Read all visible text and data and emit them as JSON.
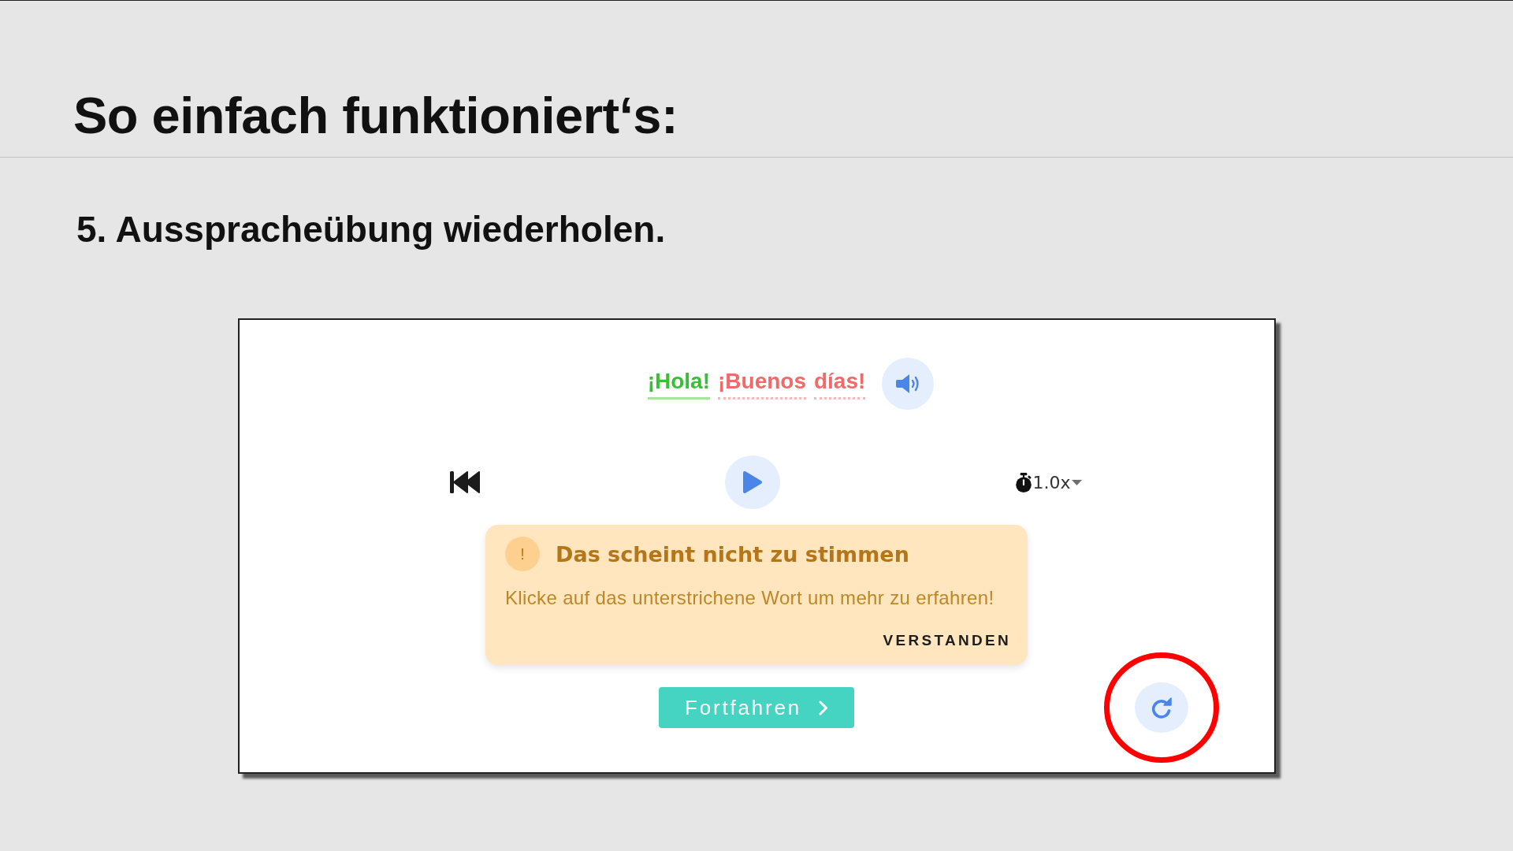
{
  "slide": {
    "title": "So einfach funktioniert‘s:",
    "step": "5. Ausspracheübung wiederholen."
  },
  "exercise": {
    "phrase": [
      {
        "text": "¡Hola!",
        "correct": true
      },
      {
        "text": "¡Buenos",
        "correct": false
      },
      {
        "text": "días!",
        "correct": false
      }
    ],
    "speed": "1.0x",
    "alert": {
      "badge": "!",
      "title": "Das scheint nicht zu stimmen",
      "message": "Klicke auf das unterstrichene Wort um mehr zu erfahren!",
      "action": "VERSTANDEN"
    },
    "continue_button": "Fortfahren",
    "retry": {
      "highlighted": true
    }
  }
}
